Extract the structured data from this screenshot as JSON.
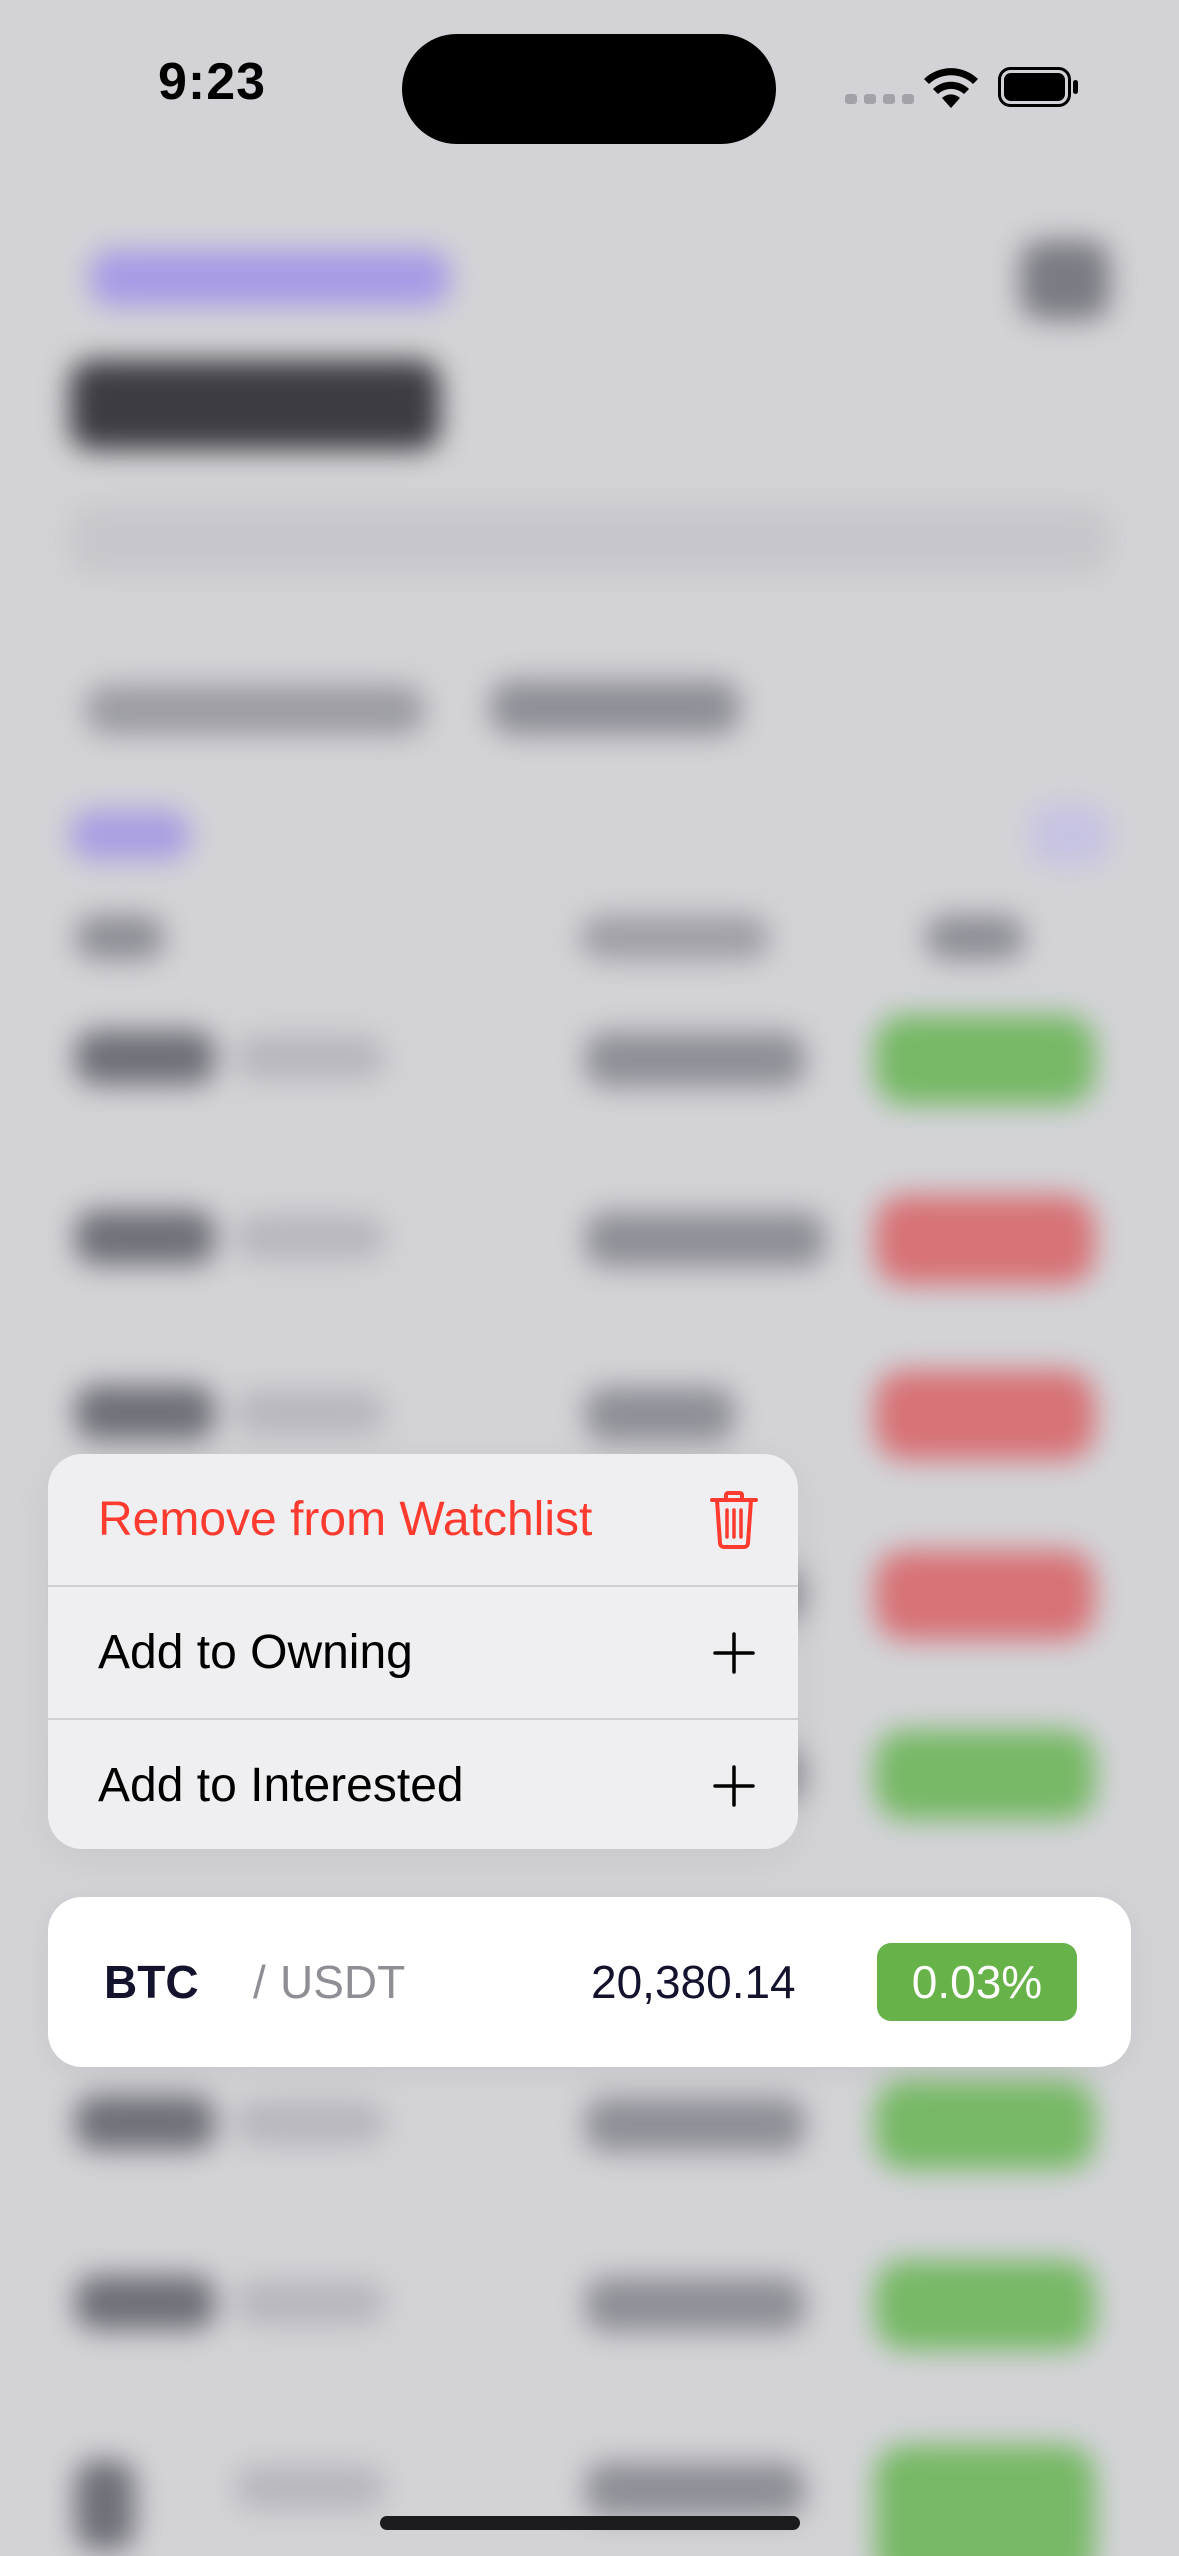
{
  "status_bar": {
    "time": "9:23"
  },
  "context_menu": {
    "items": [
      {
        "label": "Remove from Watchlist",
        "icon": "trash-icon",
        "destructive": true,
        "color": "#ff3b30"
      },
      {
        "label": "Add to Owning",
        "icon": "plus-icon",
        "destructive": false
      },
      {
        "label": "Add to Interested",
        "icon": "plus-icon",
        "destructive": false
      }
    ]
  },
  "selected_row": {
    "base": "BTC",
    "separator": "/",
    "quote": "USDT",
    "price": "20,380.14",
    "change": "0.03%",
    "change_color": "#67b34a"
  },
  "colors": {
    "positive": "#67b34a",
    "negative": "#d77276",
    "destructive": "#ff3b30",
    "accent": "#a79ae6"
  }
}
